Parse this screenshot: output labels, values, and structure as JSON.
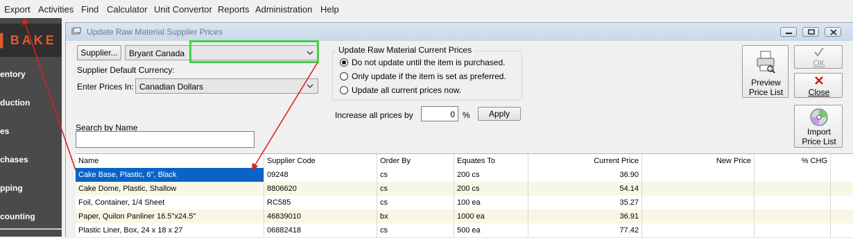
{
  "menubar": {
    "items": [
      "Export",
      "Activities",
      "Find",
      "Calculator",
      "Unit Convertor",
      "Reports",
      "Administration",
      "Help"
    ]
  },
  "sidebar": {
    "logo": "BAKE",
    "items": [
      "entory",
      "duction",
      "es",
      "chases",
      "pping",
      "counting"
    ]
  },
  "window": {
    "title": "Update Raw Material Supplier Prices"
  },
  "supplier": {
    "button_label": "Supplier...",
    "selected": "Bryant Canada",
    "default_currency_label": "Supplier Default Currency:",
    "enter_prices_label": "Enter Prices In:",
    "currency_selected": "Canadian Dollars"
  },
  "update_group": {
    "title": "Update Raw Material Current Prices",
    "options": [
      "Do not update until the item is purchased.",
      "Only update if the item is set as preferred.",
      "Update all current prices now."
    ],
    "selected_index": 0
  },
  "increase": {
    "label": "Increase all prices by",
    "value": "0",
    "unit": "%",
    "apply_label": "Apply"
  },
  "search": {
    "label": "Search by Name",
    "value": ""
  },
  "actions": {
    "preview_line1": "Preview",
    "preview_line2": "Price List",
    "ok": "OK",
    "close": "Close",
    "import_line1": "Import",
    "import_line2": "Price List"
  },
  "grid": {
    "columns": [
      "Name",
      "Supplier Code",
      "Order By",
      "Equates To",
      "Current Price",
      "New Price",
      "% CHG"
    ],
    "rows": [
      {
        "name": "Cake Base, Plastic, 6\", Black",
        "code": "09248",
        "order_by": "cs",
        "equates": "200 cs",
        "current": "36.90",
        "new": "",
        "chg": ""
      },
      {
        "name": "Cake Dome, Plastic, Shallow",
        "code": "8806620",
        "order_by": "cs",
        "equates": "200 cs",
        "current": "54.14",
        "new": "",
        "chg": ""
      },
      {
        "name": "Foil, Container, 1/4 Sheet",
        "code": "RC585",
        "order_by": "cs",
        "equates": "100 ea",
        "current": "35.27",
        "new": "",
        "chg": ""
      },
      {
        "name": "Paper, Quilon Panliner 16.5\"x24.5\"",
        "code": "46839010",
        "order_by": "bx",
        "equates": "1000 ea",
        "current": "36.91",
        "new": "",
        "chg": ""
      },
      {
        "name": "Plastic Liner, Box, 24 x 18 x 27",
        "code": "06882418",
        "order_by": "cs",
        "equates": "500 ea",
        "current": "77.42",
        "new": "",
        "chg": ""
      }
    ]
  },
  "colors": {
    "highlight": "#41d041",
    "arrow": "#e02020",
    "selection": "#0a64c8",
    "sidebar": "#4a4a4a",
    "logo_accent": "#e2592a"
  }
}
